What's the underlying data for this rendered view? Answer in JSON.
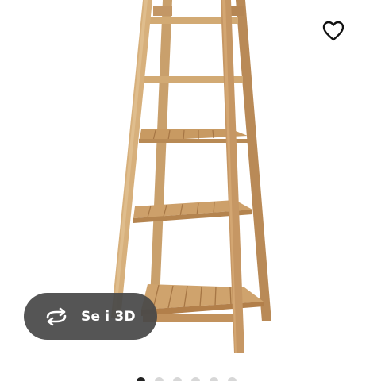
{
  "product_viewer": {
    "image_alt": "",
    "favorite_icon": "heart-outline-icon",
    "view_3d": {
      "icon": "rotate-arrows-icon",
      "label": "Se i 3D"
    },
    "pager": {
      "total": 6,
      "current": 1
    }
  },
  "colors": {
    "wood_light": "#d3ad7a",
    "wood_mid": "#c09060",
    "wood_dark": "#a27443",
    "pill_background": "#484848",
    "active_dot": "#222222",
    "inactive_dot": "#d7d7d7"
  }
}
